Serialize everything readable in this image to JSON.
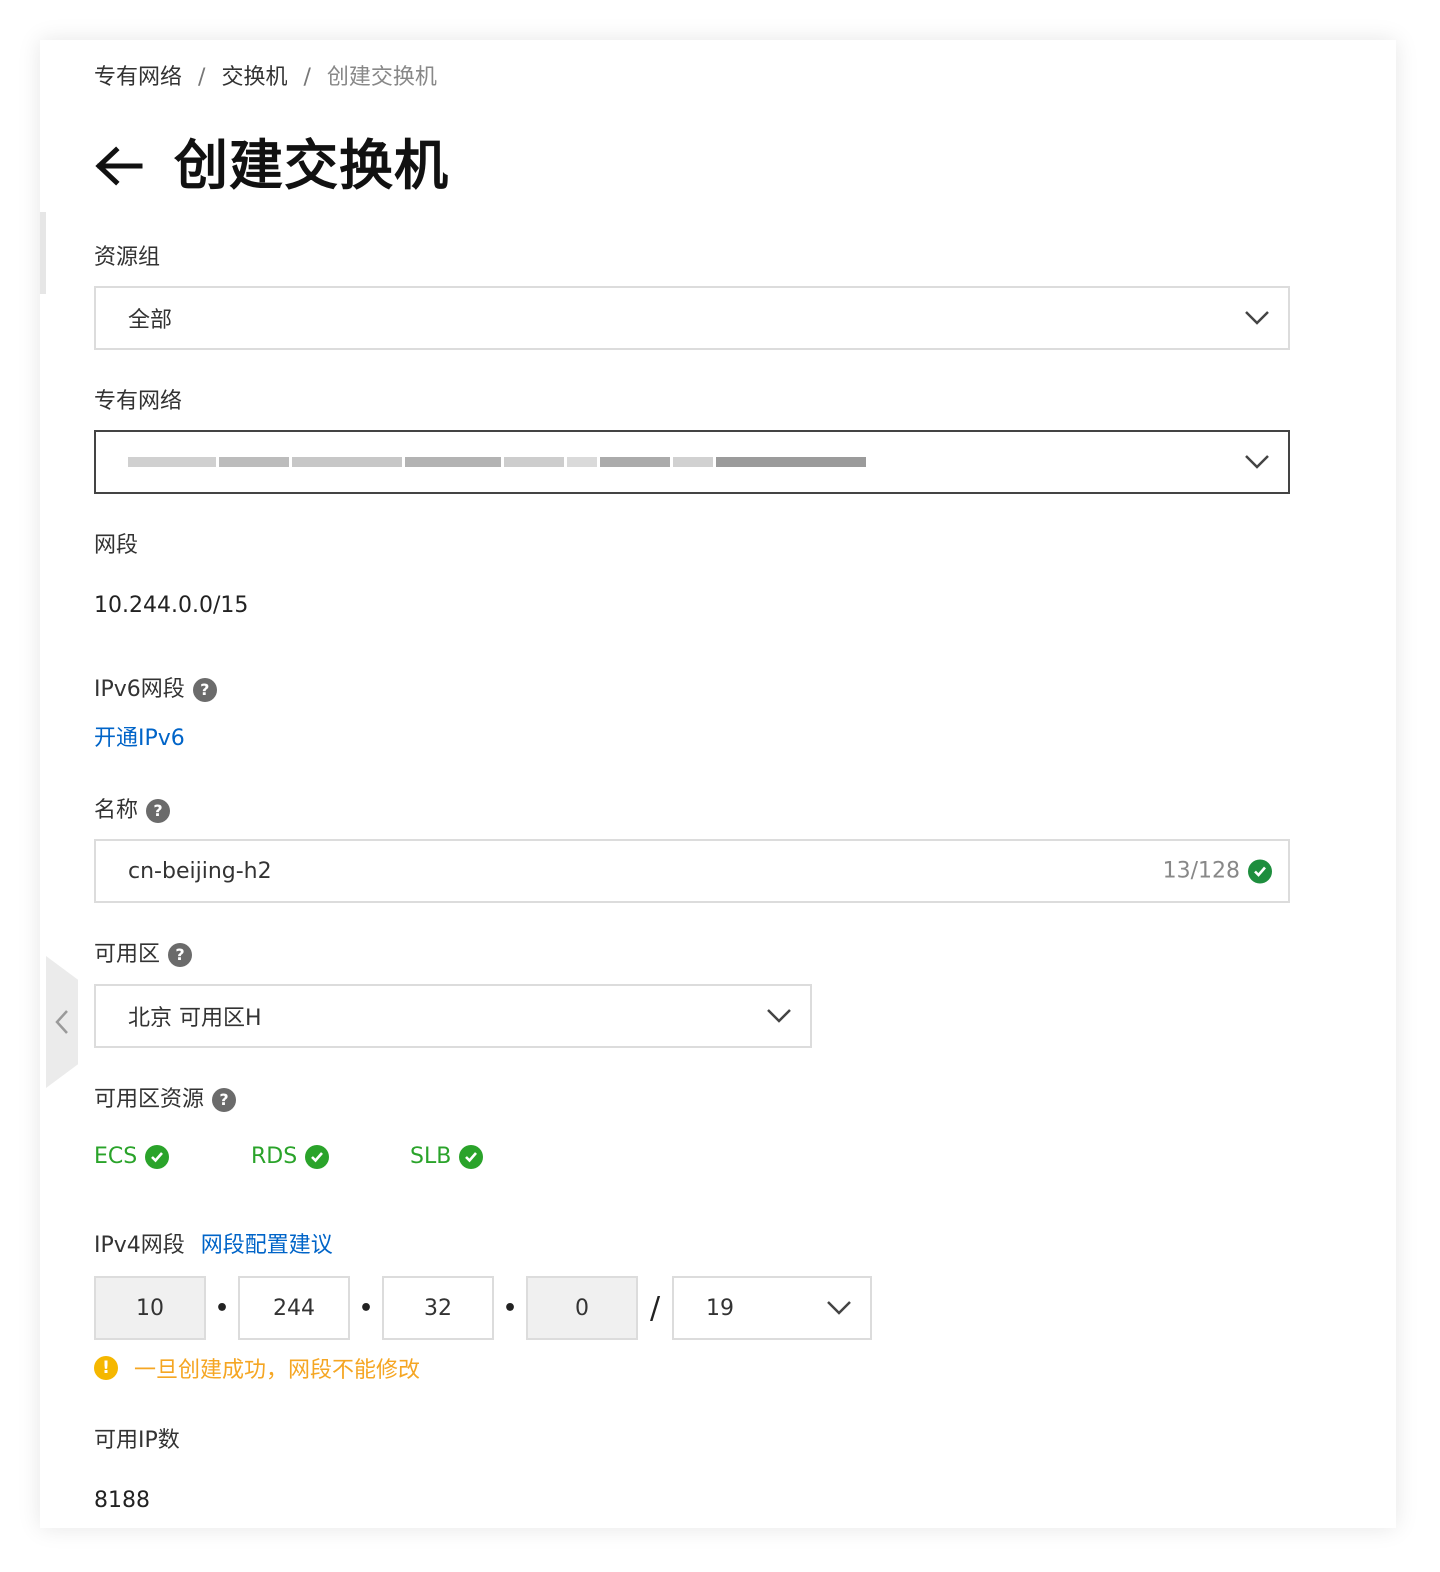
{
  "breadcrumb": {
    "item1": "专有网络",
    "item2": "交换机",
    "current": "创建交换机",
    "separator": "/"
  },
  "page_title": "创建交换机",
  "resource_group": {
    "label": "资源组",
    "value": "全部"
  },
  "vpc": {
    "label": "专有网络",
    "value_redacted": true
  },
  "cidr": {
    "label": "网段",
    "value": "10.244.0.0/15"
  },
  "ipv6": {
    "label": "IPv6网段",
    "enable_link": "开通IPv6"
  },
  "name": {
    "label": "名称",
    "value": "cn-beijing-h2",
    "counter": "13/128"
  },
  "zone": {
    "label": "可用区",
    "value": "北京 可用区H"
  },
  "zone_resources": {
    "label": "可用区资源",
    "items": [
      "ECS",
      "RDS",
      "SLB"
    ]
  },
  "ipv4": {
    "label": "IPv4网段",
    "suggest_link": "网段配置建议",
    "octets": [
      "10",
      "244",
      "32",
      "0"
    ],
    "dot": "•",
    "slash": "/",
    "mask": "19",
    "warning": "一旦创建成功，网段不能修改"
  },
  "available_ips": {
    "label": "可用IP数",
    "value": "8188"
  },
  "colors": {
    "link": "#0064c8",
    "success": "#2aa32a",
    "success_dark": "#1e8e3e",
    "warning": "#f5a623"
  },
  "icons": [
    "back-arrow-icon",
    "chevron-down-icon",
    "help-icon",
    "check-circle-icon",
    "warning-icon",
    "chevron-left-icon"
  ]
}
